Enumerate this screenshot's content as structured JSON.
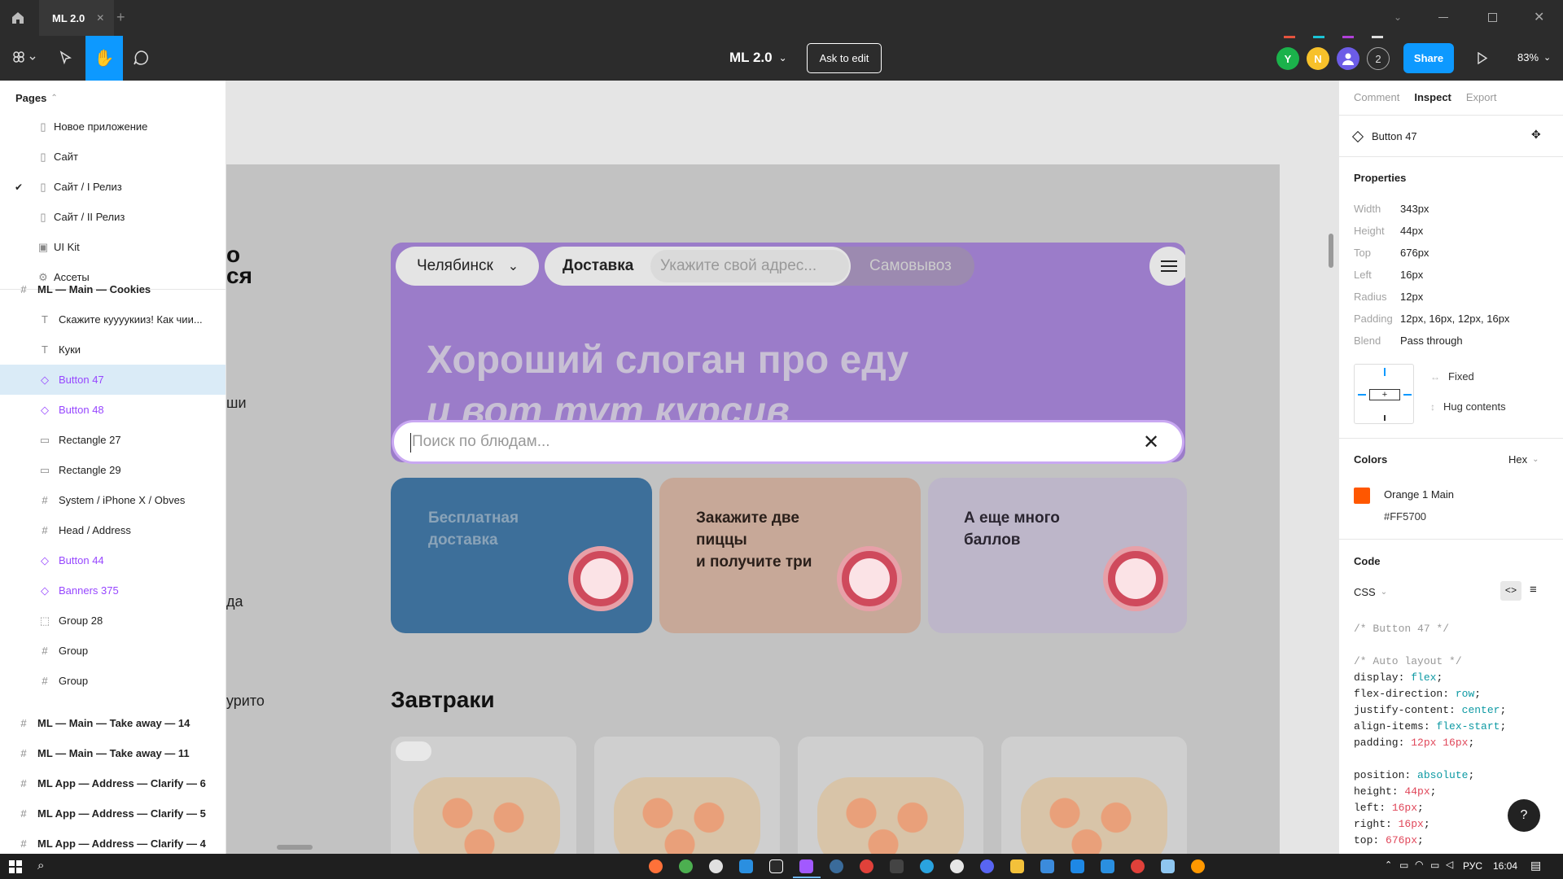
{
  "tabbar": {
    "tab_title": "ML 2.0"
  },
  "toolbar": {
    "file_name": "ML 2.0",
    "ask_edit": "Ask to edit",
    "avatar_y": "Y",
    "avatar_n": "N",
    "avatar_count": "2",
    "share": "Share",
    "zoom": "83%"
  },
  "left": {
    "pages_label": "Pages",
    "pages": [
      {
        "label": "Новое приложение"
      },
      {
        "label": "Сайт"
      },
      {
        "label": "Сайт / I Релиз"
      },
      {
        "label": "Сайт / II Релиз"
      },
      {
        "label": "UI Kit"
      },
      {
        "label": "Ассеты"
      }
    ],
    "layers": [
      {
        "label": "ML — Main — Cookies",
        "icon": "frame-icon"
      },
      {
        "label": "Скажите куууукииз! Как чии...",
        "icon": "text-icon"
      },
      {
        "label": "Куки",
        "icon": "text-icon"
      },
      {
        "label": "Button 47",
        "icon": "component-icon"
      },
      {
        "label": "Button 48",
        "icon": "component-icon"
      },
      {
        "label": "Rectangle 27",
        "icon": "rectangle-icon"
      },
      {
        "label": "Rectangle 29",
        "icon": "rectangle-icon"
      },
      {
        "label": "System / iPhone X / Obves",
        "icon": "frame-icon"
      },
      {
        "label": "Head / Address",
        "icon": "frame-icon"
      },
      {
        "label": "Button 44",
        "icon": "component-icon"
      },
      {
        "label": "Banners 375",
        "icon": "component-icon"
      },
      {
        "label": "Group 28",
        "icon": "group-icon"
      },
      {
        "label": "Group",
        "icon": "frame-icon"
      },
      {
        "label": "Group",
        "icon": "frame-icon"
      },
      {
        "label": "ML — Main — Take away — 14",
        "icon": "frame-icon"
      },
      {
        "label": "ML — Main — Take away — 11",
        "icon": "frame-icon"
      },
      {
        "label": "ML App — Address — Clarify — 6",
        "icon": "frame-icon"
      },
      {
        "label": "ML App — Address — Clarify — 5",
        "icon": "frame-icon"
      },
      {
        "label": "ML App — Address — Clarify — 4",
        "icon": "frame-icon"
      }
    ]
  },
  "canvas": {
    "partial": [
      "о",
      "ся",
      "ши",
      "да",
      "урито"
    ],
    "city": "Челябинск",
    "delivery": "Доставка",
    "address_placeholder": "Укажите свой адрес...",
    "pickup": "Самовывоз",
    "slogan1": "Хороший слоган про еду",
    "slogan2": "и вот тут курсив",
    "search_placeholder": "Поиск по блюдам...",
    "banner1": "Бесплатная\nдоставка",
    "banner2": "Закажите две\nпиццы\nи получите три",
    "banner3": "А еще много\nбаллов",
    "section_title": "Завтраки"
  },
  "right": {
    "tabs": [
      "Comment",
      "Inspect",
      "Export"
    ],
    "selected_name": "Button 47",
    "properties_title": "Properties",
    "props": [
      {
        "label": "Width",
        "value": "343px"
      },
      {
        "label": "Height",
        "value": "44px"
      },
      {
        "label": "Top",
        "value": "676px"
      },
      {
        "label": "Left",
        "value": "16px"
      },
      {
        "label": "Radius",
        "value": "12px"
      },
      {
        "label": "Padding",
        "value": "12px, 16px, 12px, 16px"
      },
      {
        "label": "Blend",
        "value": "Pass through"
      }
    ],
    "fixed": "Fixed",
    "hug": "Hug contents",
    "colors_title": "Colors",
    "hex": "Hex",
    "color_name": "Orange 1 Main",
    "color_hex": "#FF5700",
    "code_title": "Code",
    "css": "CSS"
  },
  "taskbar": {
    "lang": "РУС",
    "time": "16:04"
  },
  "colors": {
    "accent": "#0d99ff",
    "purple": "#9b7cc9",
    "orange": "#ff5700"
  }
}
